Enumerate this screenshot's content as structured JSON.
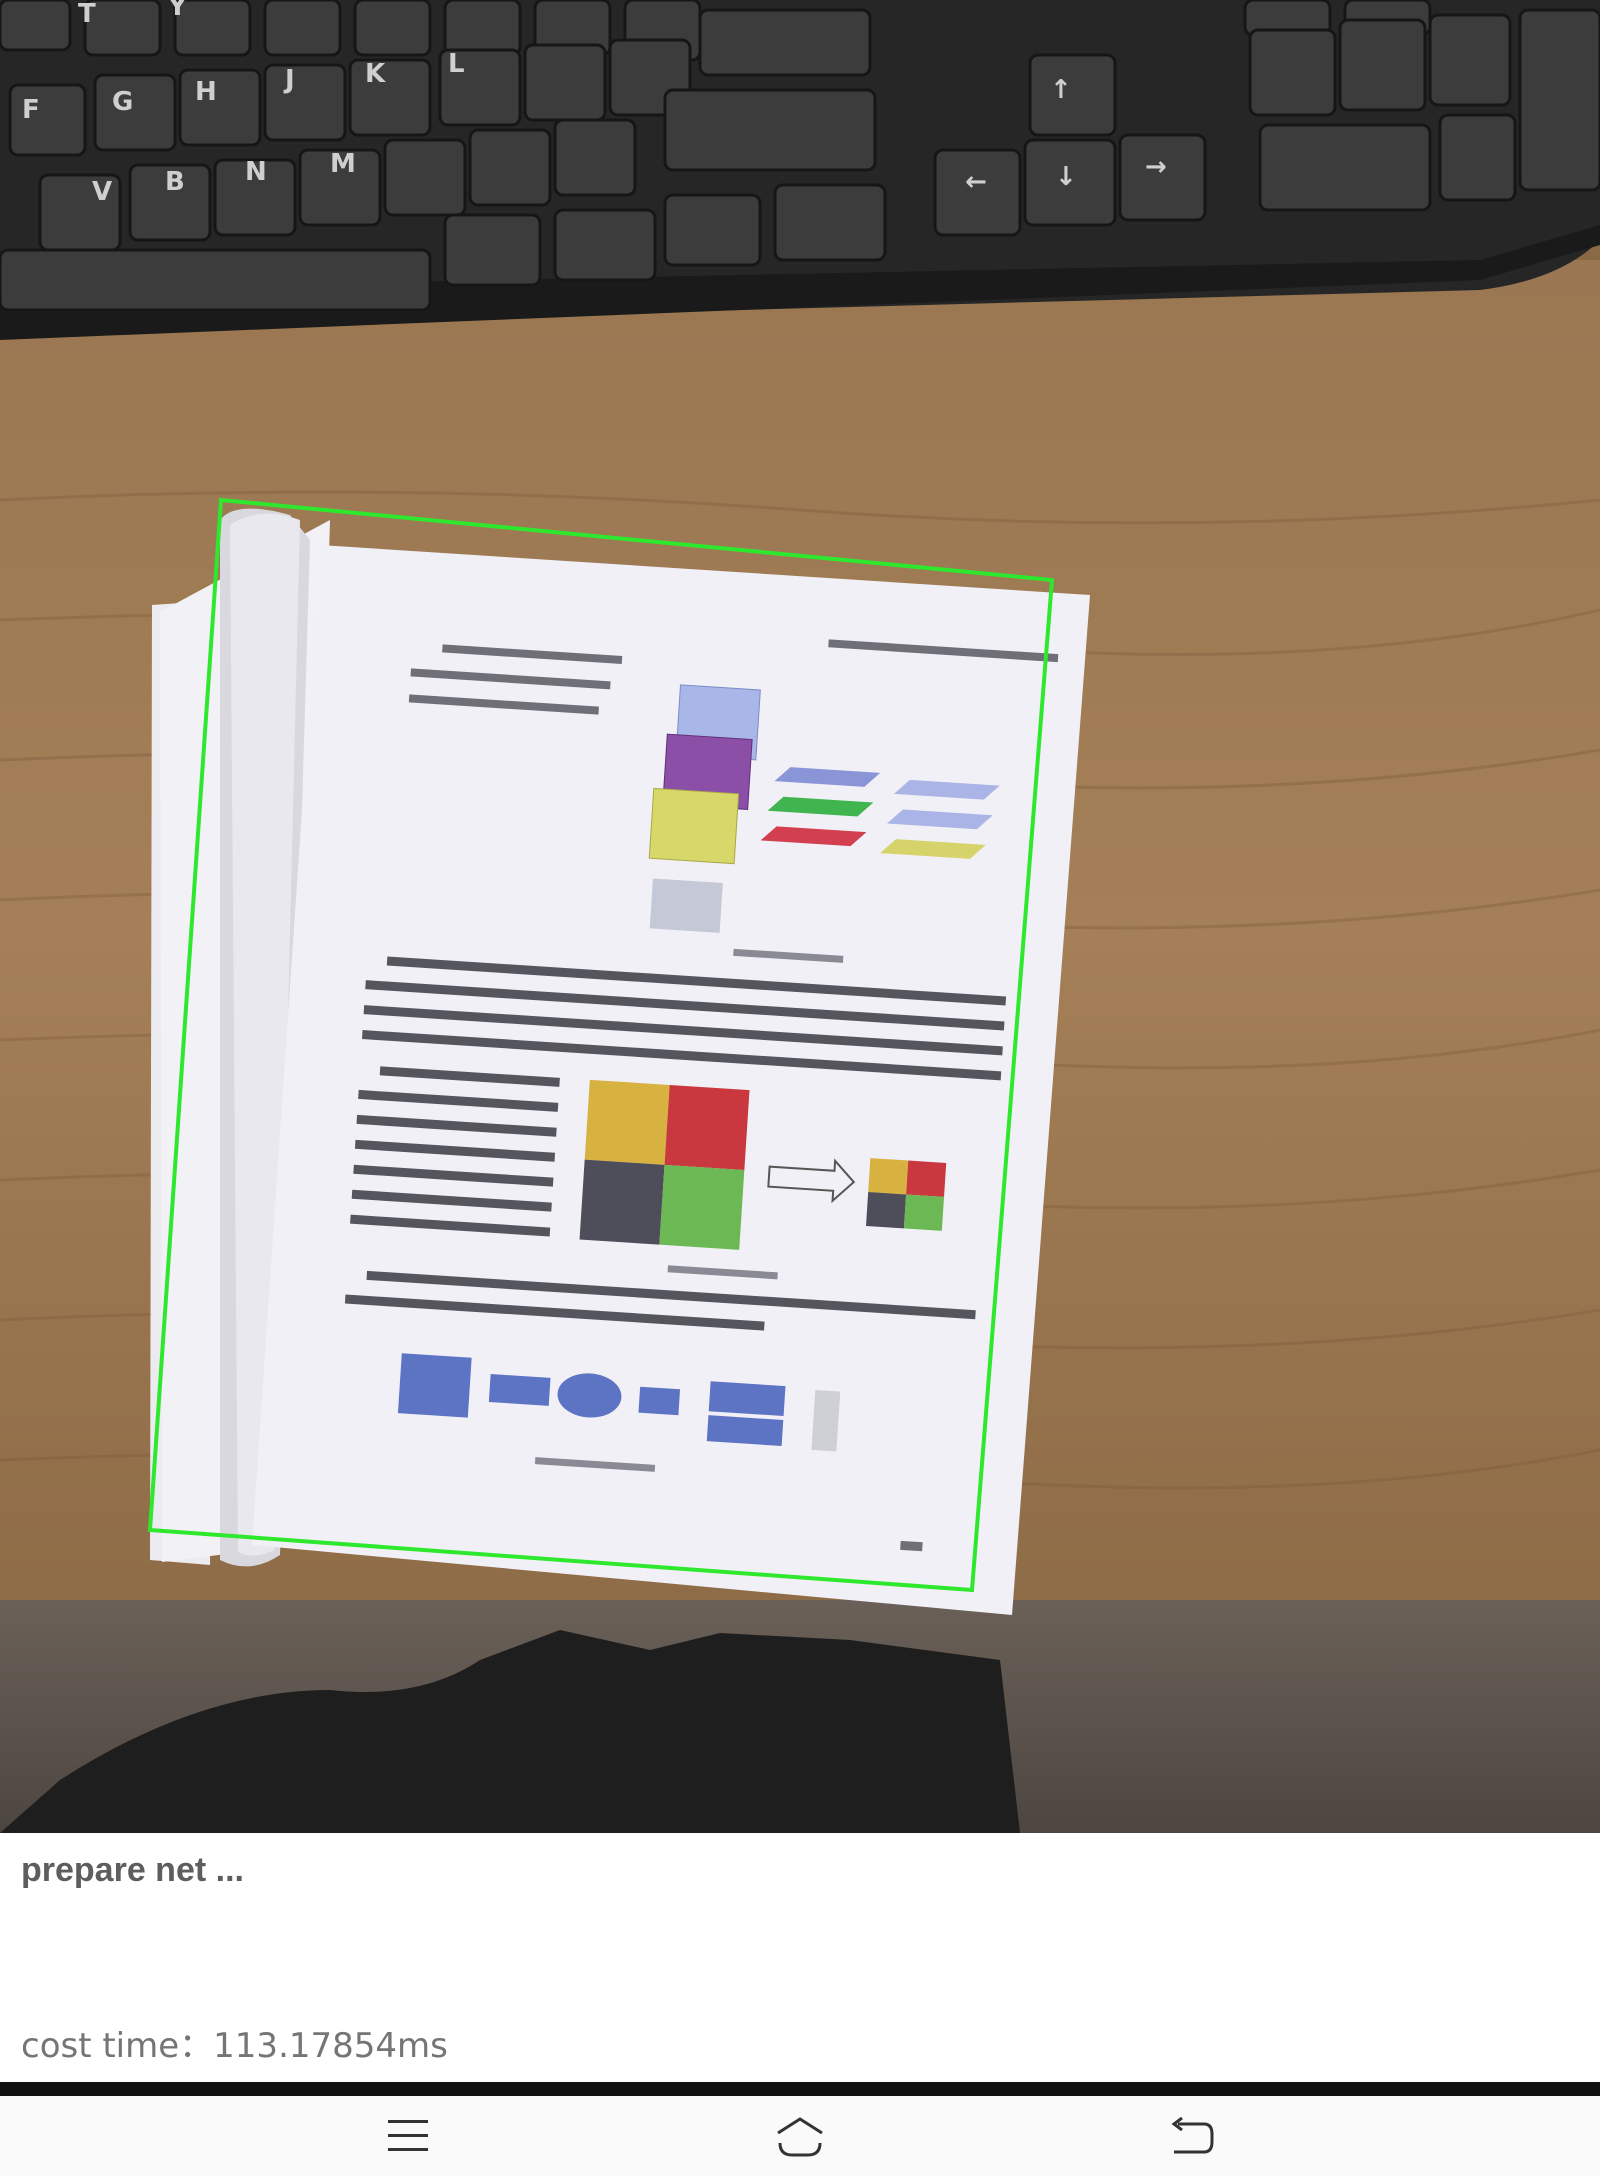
{
  "status": {
    "message": "prepare net ...",
    "cost_label": "cost time：",
    "cost_value": "113.17854ms"
  },
  "overlay": {
    "detection_color": "#2ee82e"
  },
  "navigation": {
    "menu_icon": "menu-icon",
    "home_icon": "home-icon",
    "back_icon": "back-icon"
  },
  "colors": {
    "status_text": "#5e5e5e",
    "cost_text": "#757575",
    "nav_background": "#fafafa"
  }
}
